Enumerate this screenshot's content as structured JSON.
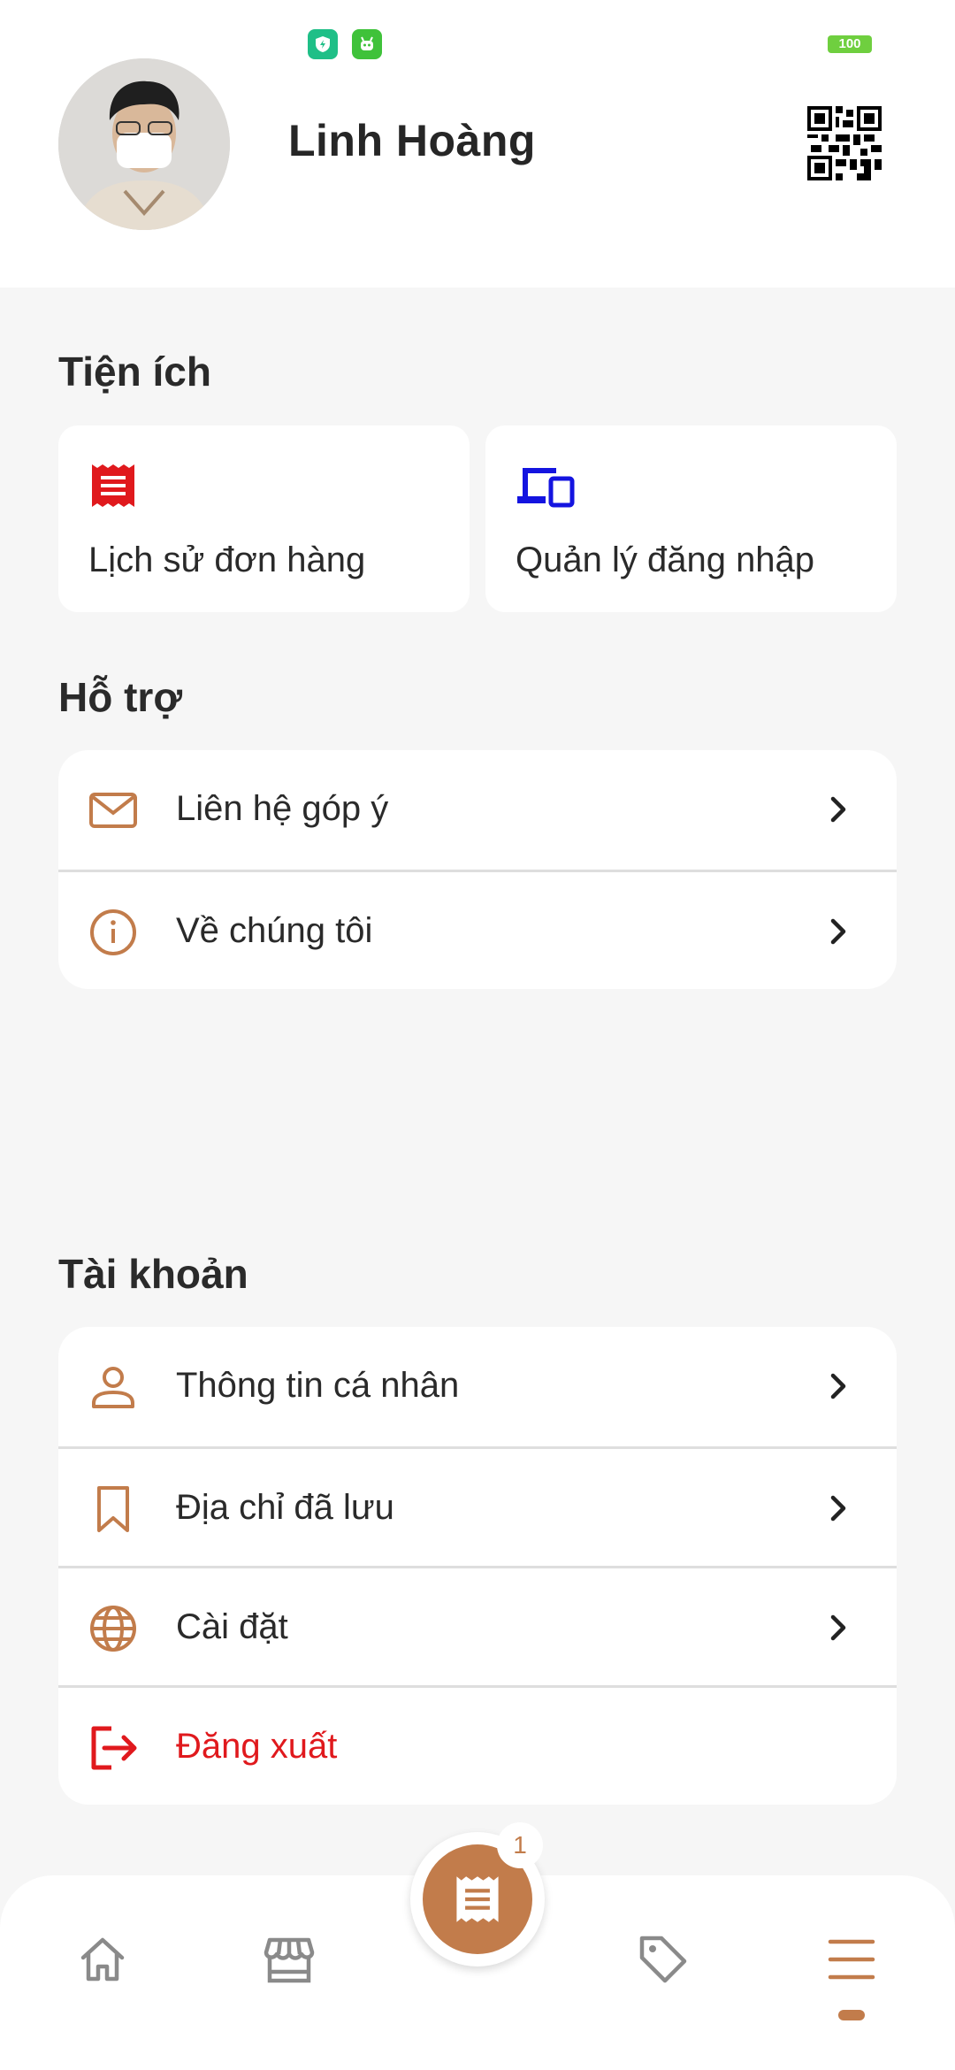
{
  "status_bar": {
    "battery": "100"
  },
  "profile": {
    "name": "Linh Hoàng",
    "qr_icon": "qr-code-icon"
  },
  "sections": {
    "utilities_title": "Tiện ích",
    "support_title": "Hỗ trợ",
    "account_title": "Tài khoản"
  },
  "utilities": [
    {
      "label": "Lịch sử đơn hàng",
      "icon": "receipt-icon",
      "color": "#e0191d"
    },
    {
      "label": "Quản lý đăng nhập",
      "icon": "devices-icon",
      "color": "#1414e0"
    }
  ],
  "support": [
    {
      "label": "Liên hệ góp ý",
      "icon": "mail-icon"
    },
    {
      "label": "Về chúng tôi",
      "icon": "info-icon"
    }
  ],
  "account": [
    {
      "label": "Thông tin cá nhân",
      "icon": "person-icon"
    },
    {
      "label": "Địa chỉ đã lưu",
      "icon": "bookmark-icon"
    },
    {
      "label": "Cài đặt",
      "icon": "globe-icon"
    },
    {
      "label": "Đăng xuất",
      "icon": "logout-icon",
      "color": "#e0191d"
    }
  ],
  "bottom_nav": {
    "items": [
      "home-icon",
      "store-icon",
      "receipt-icon",
      "tag-icon",
      "menu-icon"
    ],
    "active": "menu-icon",
    "cart_badge": "1"
  },
  "colors": {
    "accent": "#c27c4b",
    "danger": "#e0191d",
    "background": "#f6f6f6"
  }
}
